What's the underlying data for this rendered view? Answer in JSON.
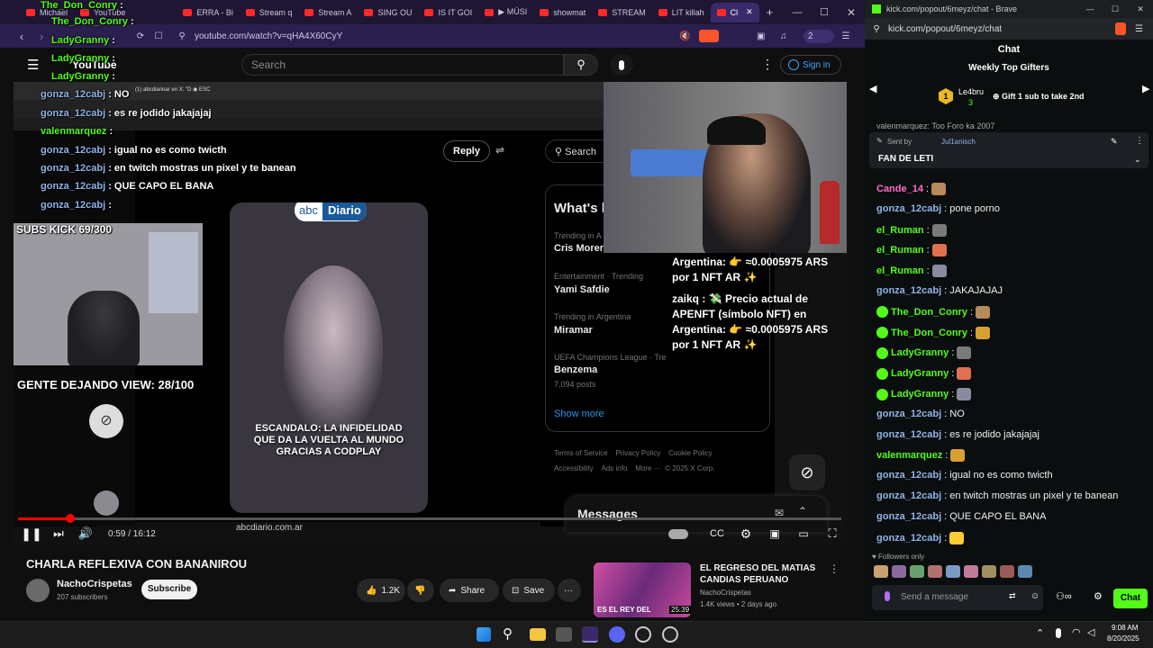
{
  "browser_left": {
    "tabs": [
      {
        "label": "Michael"
      },
      {
        "label": "YouTube"
      },
      {
        "label": "ERRA - Bi"
      },
      {
        "label": "Stream q"
      },
      {
        "label": "Stream A"
      },
      {
        "label": "SING OU"
      },
      {
        "label": "IS IT GOI"
      },
      {
        "label": "▶ MÚSI"
      },
      {
        "label": "showmat"
      },
      {
        "label": "STREAM"
      },
      {
        "label": "LIT killah"
      },
      {
        "label": "Cl"
      }
    ],
    "address": "youtube.com/watch?v=qHA4X60CyY",
    "ext_count": "2"
  },
  "youtube": {
    "logo_text": "YouTube",
    "search_placeholder": "Search",
    "sign_in": "Sign in",
    "video_title": "CHARLA REFLEXIVA CON BANANIROU",
    "channel_name": "NachoCrispetas",
    "subscribers": "207 subscribers",
    "subscribe": "Subscribe",
    "likes": "1.2K",
    "share": "Share",
    "save": "Save",
    "time": "0:59 / 16:12",
    "progress_fraction": 0.064,
    "watermark": "abcdiario.com.ar",
    "recommended": {
      "title": "EL REGRESO DEL MATIAS CANDIAS PERUANO",
      "channel": "NachoCrispetas",
      "meta": "1.4K views • 2 days ago",
      "duration": "25:39",
      "thumb_text": "ES EL REY DEL"
    }
  },
  "stream_overlay": {
    "chat_lines": [
      {
        "user": "The_Don_Conry",
        "msg": ":"
      },
      {
        "user": "The_Don_Conry",
        "msg": ":"
      },
      {
        "user": "LadyGranny",
        "msg": ":"
      },
      {
        "user": "LadyGranny",
        "msg": ":"
      },
      {
        "user": "LadyGranny",
        "msg": ":"
      },
      {
        "user": "gonza_12cabj",
        "msg": ": NO"
      },
      {
        "user": "gonza_12cabj",
        "msg": ": es re jodido jakajajaj"
      },
      {
        "user": "valenmarquez",
        "msg": ":"
      },
      {
        "user": "gonza_12cabj",
        "msg": ": igual no es como twicth"
      },
      {
        "user": "gonza_12cabj",
        "msg": ": en twitch mostras un pixel y te banean"
      },
      {
        "user": "gonza_12cabj",
        "msg": ": QUE CAPO EL BANA"
      },
      {
        "user": "gonza_12cabj",
        "msg": ":"
      }
    ],
    "subs_goal": "SUBS KICK 69/300",
    "viewers_goal": "GENTE DEJANDO VIEW: 28/100",
    "reply": "Reply",
    "x_search": "Search",
    "whats_happening": "What's h",
    "trends": [
      {
        "meta": "Trending in A",
        "name": "Cris Moren"
      },
      {
        "meta": "Entertainment · Trending",
        "name": "Yami Safdie"
      },
      {
        "meta": "Trending in Argentina",
        "name": "Miramar"
      },
      {
        "meta": "UEFA Champions League · Tre",
        "name": "Benzema",
        "posts": "7,094 posts"
      }
    ],
    "show_more": "Show more",
    "footer_links": [
      "Terms of Service",
      "Privacy Policy",
      "Cookie Policy",
      "Accessibility",
      "Ads info",
      "More ···",
      "© 2025 X Corp."
    ],
    "messages": "Messages",
    "abc_logo": [
      "abc",
      "Diario"
    ],
    "caption": "ESCANDALO: LA INFIDELIDAD QUE DA LA VUELTA AL MUNDO GRACIAS A CODPLAY",
    "bot_text": [
      "Argentina: 👉 ≈0.0005975 ARS",
      "por 1 NFT AR ✨",
      "zaikq : 💸 Precio actual de",
      "APENFT (símbolo NFT) en",
      "Argentina: 👉 ≈0.0005975 ARS",
      "por 1 NFT AR ✨"
    ],
    "inner_tab": "(1) abcdiarioar en X: \"D ◉ ESC"
  },
  "kick": {
    "tab_title": "kick.com/popout/6meyz/chat - Brave",
    "address": "kick.com/popout/6meyz/chat",
    "header": "Chat",
    "top_gifters_title": "Weekly Top Gifters",
    "gifter_name": "Le4bru",
    "gifter_count": "3",
    "gift_prompt": "Gift 1 sub to take 2nd",
    "pinned_by_label": "Sent by",
    "pinned_by": "Jul1anisch",
    "pinned_text": "FAN DE LETI",
    "partial_msg": "valenmarquez: Too Foro ka 2007",
    "messages": [
      {
        "user": "Cande_14",
        "text": ":",
        "color": "#ff6ec7"
      },
      {
        "user": "gonza_12cabj",
        "text": ": pone porno",
        "color": "#8fb3e8"
      },
      {
        "user": "el_Ruman",
        "text": ":",
        "color": "#53fc18"
      },
      {
        "user": "el_Ruman",
        "text": ":",
        "color": "#53fc18"
      },
      {
        "user": "el_Ruman",
        "text": ":",
        "color": "#53fc18"
      },
      {
        "user": "gonza_12cabj",
        "text": ": JAKAJAJAJ",
        "color": "#8fb3e8"
      },
      {
        "user": "The_Don_Conry",
        "text": ":",
        "color": "#e8c547"
      },
      {
        "user": "The_Don_Conry",
        "text": ":",
        "color": "#e8c547"
      },
      {
        "user": "LadyGranny",
        "text": ":",
        "color": "#e8c547"
      },
      {
        "user": "LadyGranny",
        "text": ":",
        "color": "#e8c547"
      },
      {
        "user": "LadyGranny",
        "text": ":",
        "color": "#e8c547"
      },
      {
        "user": "gonza_12cabj",
        "text": ": NO",
        "color": "#8fb3e8"
      },
      {
        "user": "gonza_12cabj",
        "text": ": es re jodido jakajajaj",
        "color": "#8fb3e8"
      },
      {
        "user": "valenmarquez",
        "text": ":",
        "color": "#53fc18"
      },
      {
        "user": "gonza_12cabj",
        "text": ": igual no es como twicth",
        "color": "#8fb3e8"
      },
      {
        "user": "gonza_12cabj",
        "text": ": en twitch mostras un pixel y te banean",
        "color": "#8fb3e8"
      },
      {
        "user": "gonza_12cabj",
        "text": ": QUE CAPO EL BANA",
        "color": "#8fb3e8"
      },
      {
        "user": "gonza_12cabj",
        "text": ":",
        "color": "#8fb3e8"
      }
    ],
    "followers_only": "Followers only",
    "send_placeholder": "Send a message",
    "chat_button": "Chat",
    "accent": "#53fc18"
  },
  "taskbar": {
    "time": "9:08 AM",
    "date": "8/20/2025"
  }
}
